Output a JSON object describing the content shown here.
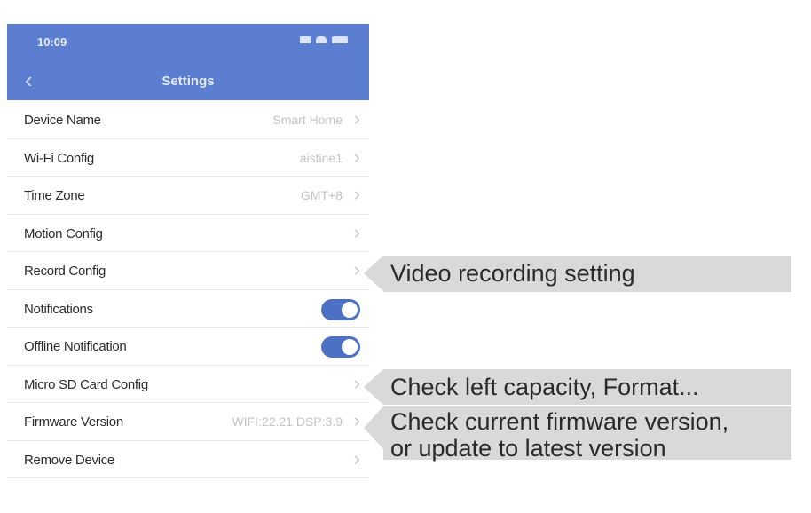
{
  "status_bar": {
    "time": "10:09"
  },
  "header": {
    "title": "Settings"
  },
  "rows": [
    {
      "label": "Device Name",
      "value": "Smart Home"
    },
    {
      "label": "Wi-Fi Config",
      "value": "aistine1"
    },
    {
      "label": "Time Zone",
      "value": "GMT+8"
    },
    {
      "label": "Motion Config",
      "value": ""
    },
    {
      "label": "Record Config",
      "value": ""
    },
    {
      "label": "Notifications",
      "toggle": "on"
    },
    {
      "label": "Offline Notification",
      "toggle": "on"
    },
    {
      "label": "Micro SD Card Config",
      "value": ""
    },
    {
      "label": "Firmware Version",
      "value": "WIFI:22.21 DSP:3.9"
    },
    {
      "label": "Remove Device",
      "value": ""
    }
  ],
  "callouts": {
    "record": "Video recording setting",
    "sdcard": "Check left capacity, Format...",
    "firmware_line1": "Check current firmware version,",
    "firmware_line2": "or update to latest version"
  },
  "colors": {
    "header": "#5b7ed0",
    "toggle_on": "#4c70c4",
    "callout_bg": "#d9d9d9"
  }
}
